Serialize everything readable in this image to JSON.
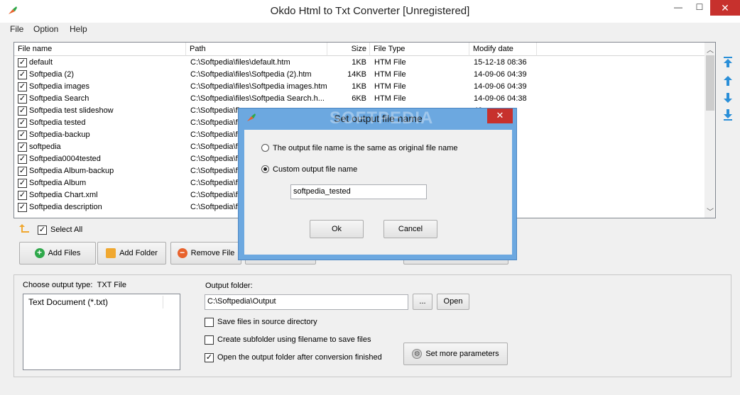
{
  "window": {
    "title": "Okdo Html to Txt Converter [Unregistered]",
    "minimize": "—",
    "maximize": "☐",
    "close": "✕"
  },
  "menu": [
    "File",
    "Option",
    "Help"
  ],
  "table": {
    "headers": [
      "File name",
      "Path",
      "Size",
      "File Type",
      "Modify date"
    ],
    "rows": [
      {
        "name": "default",
        "path": "C:\\Softpedia\\files\\default.htm",
        "size": "1KB",
        "type": "HTM File",
        "date": "15-12-18 08:36"
      },
      {
        "name": "Softpedia (2)",
        "path": "C:\\Softpedia\\files\\Softpedia (2).htm",
        "size": "14KB",
        "type": "HTM File",
        "date": "14-09-06 04:39"
      },
      {
        "name": "Softpedia images",
        "path": "C:\\Softpedia\\files\\Softpedia images.htm",
        "size": "1KB",
        "type": "HTM File",
        "date": "14-09-06 04:39"
      },
      {
        "name": "Softpedia Search",
        "path": "C:\\Softpedia\\files\\Softpedia Search.h...",
        "size": "6KB",
        "type": "HTM File",
        "date": "14-09-06 04:38"
      },
      {
        "name": "Softpedia test slideshow",
        "path": "C:\\Softpedia\\fi",
        "size": "",
        "type": "",
        "date": "42"
      },
      {
        "name": "Softpedia tested",
        "path": "C:\\Softpedia\\fi",
        "size": "",
        "type": "",
        "date": "38"
      },
      {
        "name": "Softpedia-backup",
        "path": "C:\\Softpedia\\fi",
        "size": "",
        "type": "",
        "date": "42"
      },
      {
        "name": "softpedia",
        "path": "C:\\Softpedia\\fi",
        "size": "",
        "type": "",
        "date": "38"
      },
      {
        "name": "Softpedia0004tested",
        "path": "C:\\Softpedia\\fi",
        "size": "",
        "type": "",
        "date": "38"
      },
      {
        "name": "Softpedia Album-backup",
        "path": "C:\\Softpedia\\fi",
        "size": "",
        "type": "",
        "date": "38"
      },
      {
        "name": "Softpedia Album",
        "path": "C:\\Softpedia\\fi",
        "size": "",
        "type": "",
        "date": "42"
      },
      {
        "name": "Softpedia Chart.xml",
        "path": "C:\\Softpedia\\fi",
        "size": "",
        "type": "",
        "date": "23"
      },
      {
        "name": "Softpedia description",
        "path": "C:\\Softpedia\\fi",
        "size": "",
        "type": "",
        "date": "39"
      }
    ]
  },
  "list_actions": {
    "select_all": "Select All",
    "add_files": "Add Files",
    "add_folder": "Add Folder",
    "remove_file": "Remove File"
  },
  "output": {
    "type_label": "Choose output type:",
    "type_value": "TXT File",
    "type_options": [
      "Text Document (*.txt)"
    ],
    "folder_label": "Output folder:",
    "folder_value": "C:\\Softpedia\\Output",
    "browse": "...",
    "open": "Open",
    "opt_source_dir": "Save files in source directory",
    "opt_subfolder": "Create subfolder using filename to save files",
    "opt_open_after": "Open the output folder after conversion finished",
    "more_params": "Set more parameters"
  },
  "dialog": {
    "title": "Set output file name",
    "close": "✕",
    "option_same": "The output file name is the same as original file name",
    "option_custom": "Custom output file name",
    "custom_value": "softpedia_tested",
    "ok": "Ok",
    "cancel": "Cancel"
  },
  "watermark": "SOFTPEDIA",
  "colors": {
    "dialog_frame": "#6ca8e0",
    "close_red": "#c7312d",
    "arrow_blue": "#2a8fd8",
    "add_green": "#2ea84a",
    "folder_orange": "#f0a830",
    "remove_orange": "#e8622c"
  }
}
